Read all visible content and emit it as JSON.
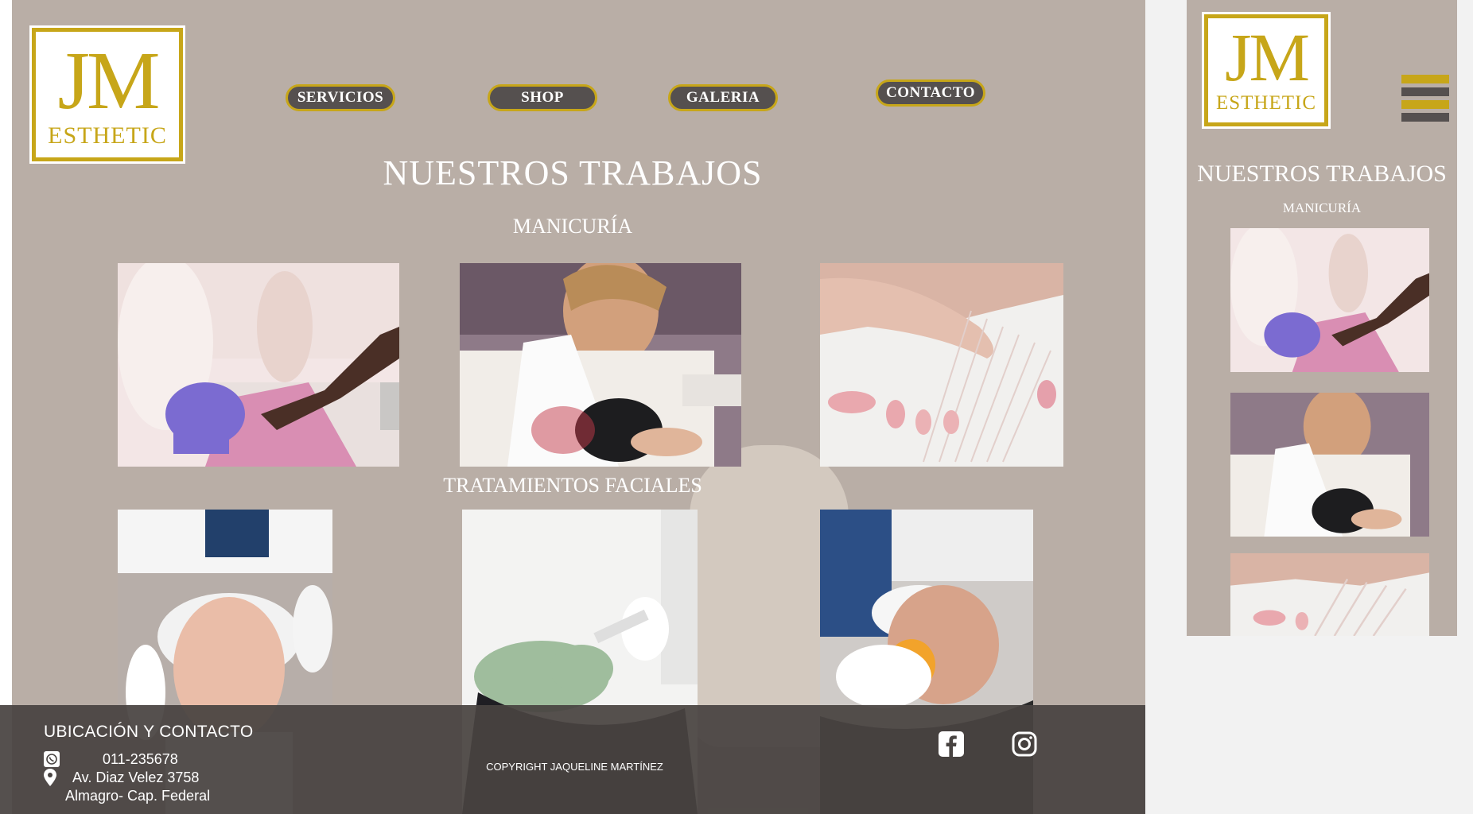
{
  "brand": {
    "logo_main": "JM",
    "logo_sub": "ESTHETIC",
    "gold": "#c7a619",
    "dark": "#55504f",
    "background": "#b9aea6"
  },
  "nav": {
    "items": [
      {
        "label": "SERVICIOS"
      },
      {
        "label": "SHOP"
      },
      {
        "label": "GALERIA"
      },
      {
        "label": "CONTACTO"
      }
    ]
  },
  "gallery": {
    "title": "NUESTROS TRABAJOS",
    "sections": [
      {
        "title": "MANICURÍA"
      },
      {
        "title": "TRATAMIENTOS FACIALES"
      }
    ]
  },
  "footer": {
    "heading": "UBICACIÓN Y CONTACTO",
    "phone": "011-235678",
    "address_line1": "Av. Diaz Velez 3758",
    "address_line2": "Almagro- Cap. Federal",
    "copyright": "COPYRIGHT JAQUELINE MARTÍNEZ",
    "icons": [
      "whatsapp-icon",
      "location-pin-icon",
      "facebook-icon",
      "instagram-icon"
    ]
  },
  "mobile": {
    "title": "NUESTROS TRABAJOS",
    "section": "MANICURÍA",
    "menu_icon": "hamburger-menu-icon"
  }
}
